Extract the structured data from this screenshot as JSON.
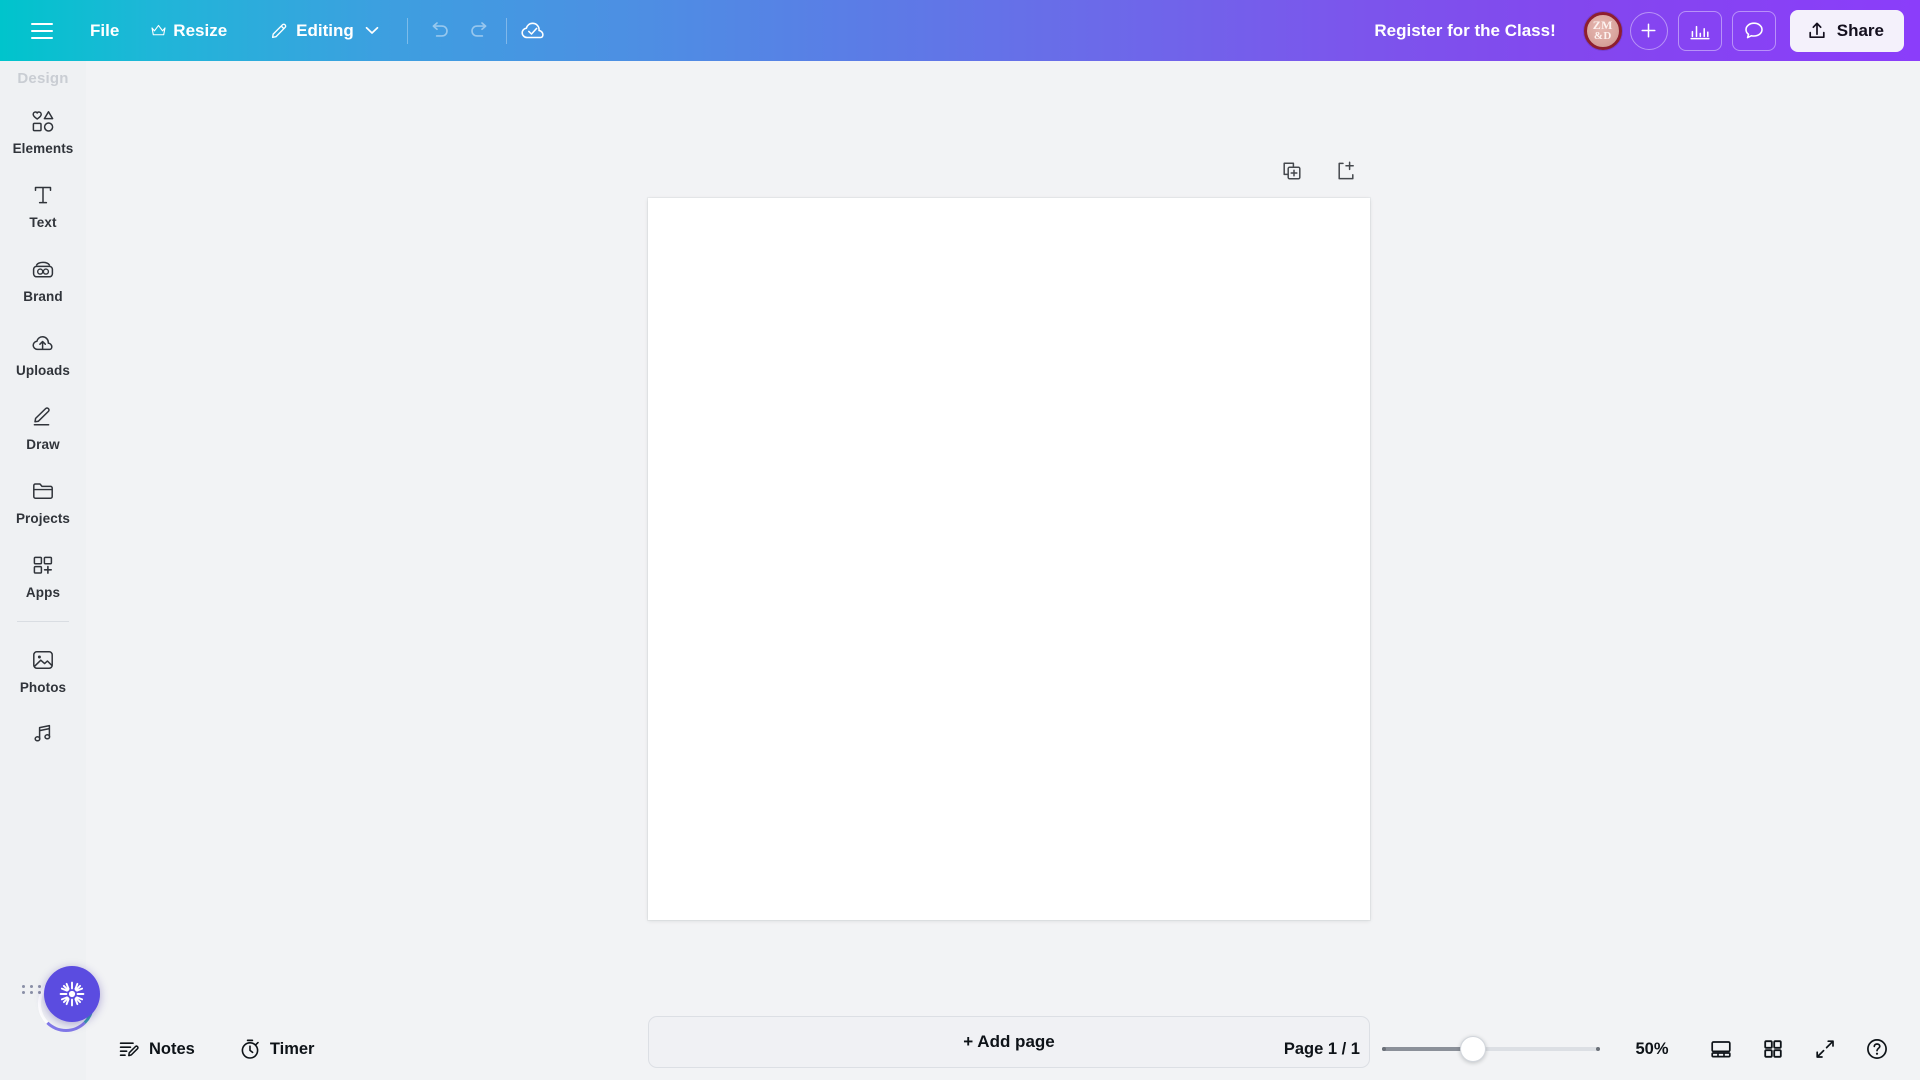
{
  "topbar": {
    "menu_icon": "hamburger-icon",
    "file_label": "File",
    "resize_label": "Resize",
    "resize_badge_icon": "crown-icon",
    "editing_label": "Editing",
    "editing_icon": "pencil-icon",
    "editing_chevron": "chevron-down-icon",
    "undo_icon": "undo-icon",
    "redo_icon": "redo-icon",
    "saved_icon": "cloud-check-icon",
    "doc_title": "Register for the Class!",
    "avatar": {
      "line1": "ZM",
      "line2": "&D",
      "name": "user-avatar"
    },
    "add_collaborator_icon": "plus-icon",
    "insights_icon": "bar-chart-icon",
    "comments_icon": "comment-bubble-icon",
    "share_label": "Share",
    "share_icon": "upload-icon",
    "gradient_start": "#00c4cc",
    "gradient_end": "#8b3dfa"
  },
  "sidebar": {
    "header": "Design",
    "items": [
      {
        "label": "Elements",
        "icon": "shapes-icon"
      },
      {
        "label": "Text",
        "icon": "text-t-icon"
      },
      {
        "label": "Brand",
        "icon": "brand-icon"
      },
      {
        "label": "Uploads",
        "icon": "cloud-upload-icon"
      },
      {
        "label": "Draw",
        "icon": "pen-draw-icon"
      },
      {
        "label": "Projects",
        "icon": "folder-icon"
      },
      {
        "label": "Apps",
        "icon": "apps-grid-plus-icon"
      }
    ],
    "items_after_divider": [
      {
        "label": "Photos",
        "icon": "image-icon"
      },
      {
        "label": "",
        "icon": "music-note-icon"
      }
    ],
    "magic_button": {
      "icon": "magic-sparkle-icon",
      "color": "#5b4ce0",
      "state": "loading"
    }
  },
  "canvas": {
    "duplicate_page_icon": "duplicate-page-icon",
    "add_page_icon": "add-page-icon",
    "page_background": "#ffffff",
    "add_page_label": "+ Add page"
  },
  "bottombar": {
    "notes_label": "Notes",
    "notes_icon": "notes-icon",
    "timer_label": "Timer",
    "timer_icon": "stopwatch-icon",
    "page_indicator": "Page 1 / 1",
    "zoom_value": "50%",
    "zoom_percent": 50,
    "present_icon": "present-view-icon",
    "grid_icon": "grid-view-icon",
    "fullscreen_icon": "fullscreen-icon",
    "help_icon": "help-circle-icon"
  }
}
